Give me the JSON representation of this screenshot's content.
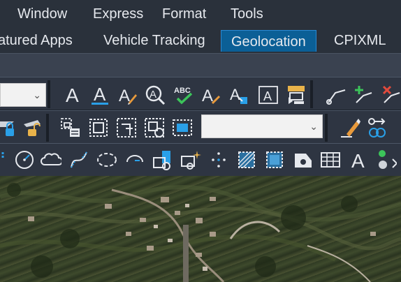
{
  "menubar": {
    "items": [
      "Window",
      "Express",
      "Format",
      "Tools"
    ]
  },
  "ribbon_tabs": [
    {
      "label": "atured Apps",
      "active": false
    },
    {
      "label": "Vehicle Tracking",
      "active": false
    },
    {
      "label": "Geolocation",
      "active": true
    },
    {
      "label": "CPIXML",
      "active": false
    }
  ],
  "toolbar_icons": {
    "row1": [
      "text-style-icon",
      "text-underline-icon",
      "text-edit-icon",
      "find-text-icon",
      "spell-check-icon",
      "text-align-icon",
      "text-scale-icon",
      "text-frame-icon",
      "text-mask-icon",
      "leader-icon",
      "add-leader-icon",
      "remove-leader-icon"
    ],
    "row2": [
      "lock-layer-icon",
      "unlock-layer-icon",
      "group-icon",
      "block-icon",
      "xref-icon",
      "attach-icon",
      "clip-icon",
      "match-prop-icon",
      "link-icon"
    ],
    "row3": [
      "circle-icon",
      "cloud-icon",
      "spline-icon",
      "ellipse-icon",
      "arc-icon",
      "insert-block-icon",
      "insert-new-icon",
      "point-icon",
      "hatch-icon",
      "region-icon",
      "wipeout-icon",
      "table-icon",
      "mtext-icon",
      "select-icon"
    ]
  },
  "combo_style": {
    "value": ""
  },
  "combo_layer": {
    "value": ""
  },
  "colors": {
    "accent": "#0b5f96",
    "menubar": "#2a313b",
    "toolbar": "#2e3542"
  }
}
